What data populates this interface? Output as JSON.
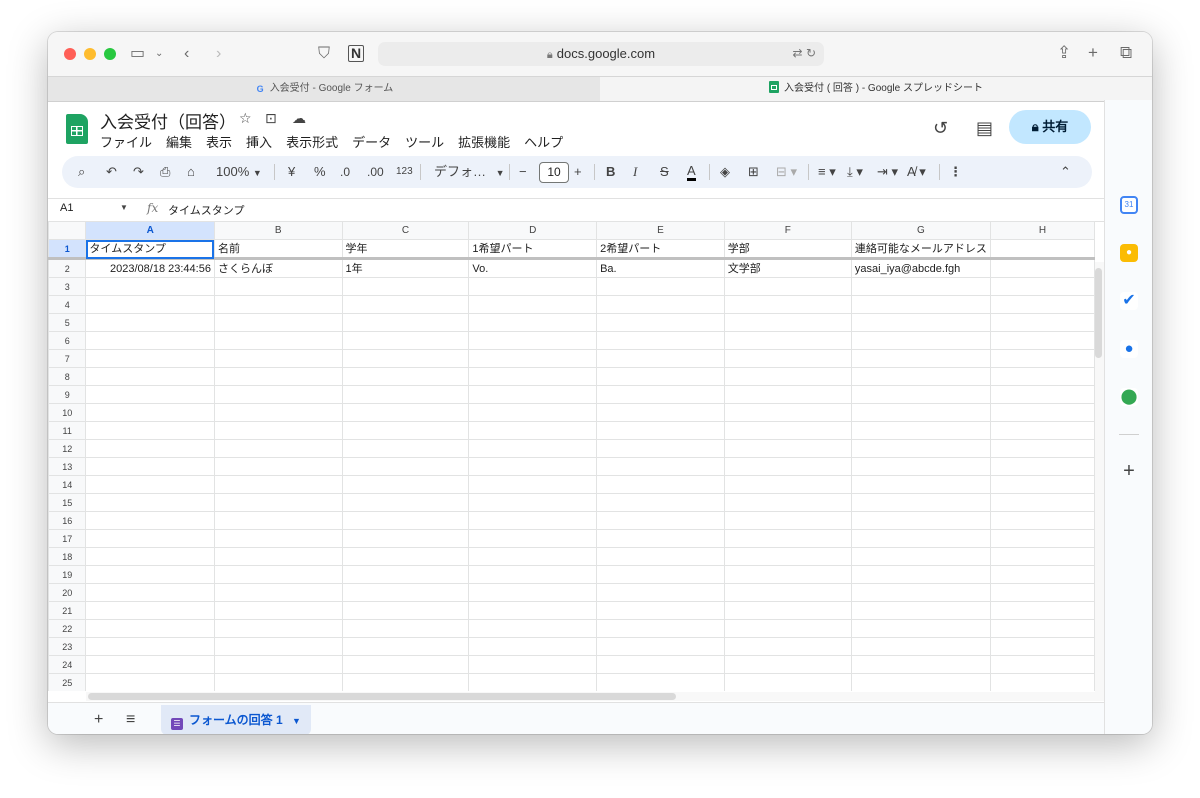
{
  "browser": {
    "url": "docs.google.com",
    "tabs": [
      {
        "label": "入会受付 - Google フォーム",
        "active": false
      },
      {
        "label": "入会受付 ( 回答 ) - Google スプレッドシート",
        "active": true
      }
    ]
  },
  "doc": {
    "title": "入会受付（回答）",
    "menu": [
      "ファイル",
      "編集",
      "表示",
      "挿入",
      "表示形式",
      "データ",
      "ツール",
      "拡張機能",
      "ヘルプ"
    ],
    "share_label": "共有"
  },
  "format_toolbar": {
    "zoom": "100%",
    "currency": "¥",
    "percent": "%",
    "dec_decrease": ".0",
    "dec_increase": ".00",
    "number_format": "123",
    "font": "デフォ…",
    "font_size": "10",
    "bold": "B",
    "italic": "I",
    "strike": "S",
    "text_color": "A"
  },
  "formula_bar": {
    "cell_ref": "A1",
    "fx": "fx",
    "value": "タイムスタンプ"
  },
  "grid": {
    "columns": [
      "A",
      "B",
      "C",
      "D",
      "E",
      "F",
      "G",
      "H"
    ],
    "rows": [
      {
        "num": "1",
        "cells": [
          "タイムスタンプ",
          "名前",
          "学年",
          "1希望パート",
          "2希望パート",
          "学部",
          "連絡可能なメールアドレス",
          ""
        ]
      },
      {
        "num": "2",
        "cells": [
          "2023/08/18 23:44:56",
          "さくらんぼ",
          "1年",
          "Vo.",
          "Ba.",
          "文学部",
          "yasai_iya@abcde.fgh",
          ""
        ]
      },
      {
        "num": "3",
        "cells": [
          "",
          "",
          "",
          "",
          "",
          "",
          "",
          ""
        ]
      },
      {
        "num": "4",
        "cells": [
          "",
          "",
          "",
          "",
          "",
          "",
          "",
          ""
        ]
      },
      {
        "num": "5",
        "cells": [
          "",
          "",
          "",
          "",
          "",
          "",
          "",
          ""
        ]
      },
      {
        "num": "6",
        "cells": [
          "",
          "",
          "",
          "",
          "",
          "",
          "",
          ""
        ]
      },
      {
        "num": "7",
        "cells": [
          "",
          "",
          "",
          "",
          "",
          "",
          "",
          ""
        ]
      },
      {
        "num": "8",
        "cells": [
          "",
          "",
          "",
          "",
          "",
          "",
          "",
          ""
        ]
      },
      {
        "num": "9",
        "cells": [
          "",
          "",
          "",
          "",
          "",
          "",
          "",
          ""
        ]
      },
      {
        "num": "10",
        "cells": [
          "",
          "",
          "",
          "",
          "",
          "",
          "",
          ""
        ]
      },
      {
        "num": "11",
        "cells": [
          "",
          "",
          "",
          "",
          "",
          "",
          "",
          ""
        ]
      },
      {
        "num": "12",
        "cells": [
          "",
          "",
          "",
          "",
          "",
          "",
          "",
          ""
        ]
      },
      {
        "num": "13",
        "cells": [
          "",
          "",
          "",
          "",
          "",
          "",
          "",
          ""
        ]
      },
      {
        "num": "14",
        "cells": [
          "",
          "",
          "",
          "",
          "",
          "",
          "",
          ""
        ]
      },
      {
        "num": "15",
        "cells": [
          "",
          "",
          "",
          "",
          "",
          "",
          "",
          ""
        ]
      },
      {
        "num": "16",
        "cells": [
          "",
          "",
          "",
          "",
          "",
          "",
          "",
          ""
        ]
      },
      {
        "num": "17",
        "cells": [
          "",
          "",
          "",
          "",
          "",
          "",
          "",
          ""
        ]
      },
      {
        "num": "18",
        "cells": [
          "",
          "",
          "",
          "",
          "",
          "",
          "",
          ""
        ]
      },
      {
        "num": "19",
        "cells": [
          "",
          "",
          "",
          "",
          "",
          "",
          "",
          ""
        ]
      },
      {
        "num": "20",
        "cells": [
          "",
          "",
          "",
          "",
          "",
          "",
          "",
          ""
        ]
      },
      {
        "num": "21",
        "cells": [
          "",
          "",
          "",
          "",
          "",
          "",
          "",
          ""
        ]
      },
      {
        "num": "22",
        "cells": [
          "",
          "",
          "",
          "",
          "",
          "",
          "",
          ""
        ]
      },
      {
        "num": "23",
        "cells": [
          "",
          "",
          "",
          "",
          "",
          "",
          "",
          ""
        ]
      },
      {
        "num": "24",
        "cells": [
          "",
          "",
          "",
          "",
          "",
          "",
          "",
          ""
        ]
      },
      {
        "num": "25",
        "cells": [
          "",
          "",
          "",
          "",
          "",
          "",
          "",
          ""
        ]
      }
    ]
  },
  "sheet_tab": {
    "label": "フォームの回答 1"
  },
  "colors": {
    "sheets_green": "#1ea362",
    "selection_blue": "#1a73e8",
    "share_bg": "#c2e7ff",
    "tab_purple": "#7248b9"
  }
}
